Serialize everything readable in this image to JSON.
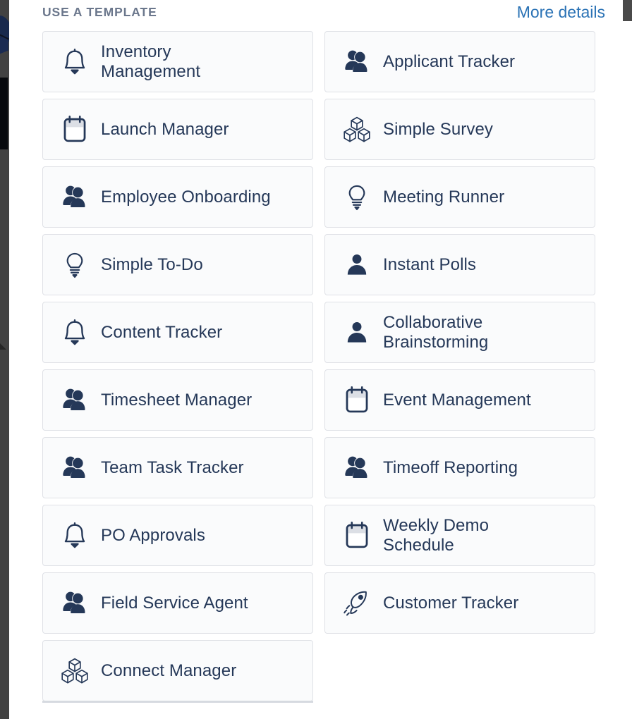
{
  "header": {
    "section_title": "USE A TEMPLATE",
    "more_details_label": "More details",
    "link_color": "#2a72b5",
    "title_color": "#6b778c"
  },
  "theme": {
    "card_bg": "#fafbfc",
    "card_border": "#dfe1e6",
    "text_color": "#253858",
    "chrome_strip": "#424242",
    "page_bg": "#ffffff"
  },
  "templates": [
    {
      "label": "Inventory\nManagement",
      "icon": "bell-icon"
    },
    {
      "label": "Applicant Tracker",
      "icon": "people-icon"
    },
    {
      "label": "Launch Manager",
      "icon": "calendar-icon"
    },
    {
      "label": "Simple Survey",
      "icon": "cubes-icon"
    },
    {
      "label": "Employee Onboarding",
      "icon": "people-icon"
    },
    {
      "label": "Meeting Runner",
      "icon": "lightbulb-icon"
    },
    {
      "label": "Simple To-Do",
      "icon": "lightbulb-icon"
    },
    {
      "label": "Instant Polls",
      "icon": "person-icon"
    },
    {
      "label": "Content Tracker",
      "icon": "bell-icon"
    },
    {
      "label": "Collaborative\nBrainstorming",
      "icon": "person-icon"
    },
    {
      "label": "Timesheet Manager",
      "icon": "people-icon"
    },
    {
      "label": "Event Management",
      "icon": "calendar-icon"
    },
    {
      "label": "Team Task Tracker",
      "icon": "people-icon"
    },
    {
      "label": "Timeoff Reporting",
      "icon": "people-icon"
    },
    {
      "label": "PO Approvals",
      "icon": "bell-icon"
    },
    {
      "label": "Weekly Demo\nSchedule",
      "icon": "calendar-icon"
    },
    {
      "label": "Field Service Agent",
      "icon": "people-icon"
    },
    {
      "label": "Customer Tracker",
      "icon": "rocket-icon"
    },
    {
      "label": "Connect Manager",
      "icon": "cubes-icon"
    }
  ]
}
